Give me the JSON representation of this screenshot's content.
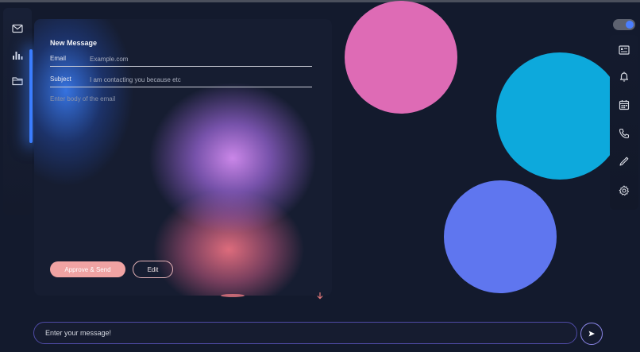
{
  "colors": {
    "background": "#131a2d",
    "accent": "#3b7dff",
    "approve_button": "#f0a3a3",
    "circle_pink": "#de6bb5",
    "circle_cyan": "#0da9dc",
    "circle_blue": "#5f76ef"
  },
  "left_sidebar": {
    "items": [
      {
        "icon": "mail-icon"
      },
      {
        "icon": "bar-chart-icon"
      },
      {
        "icon": "folder-icon"
      }
    ]
  },
  "compose": {
    "title": "New Message",
    "email": {
      "label": "Email",
      "placeholder": "Example.com"
    },
    "subject": {
      "label": "Subject",
      "placeholder": "I am contacting you because etc"
    },
    "body": {
      "placeholder": "Enter body of the email"
    },
    "approve_label": "Approve & Send",
    "edit_label": "Edit"
  },
  "right_sidebar": {
    "theme_toggle_on": true,
    "items": [
      {
        "icon": "contact-card-icon"
      },
      {
        "icon": "bell-icon"
      },
      {
        "icon": "calendar-icon"
      },
      {
        "icon": "phone-icon"
      },
      {
        "icon": "pen-icon"
      },
      {
        "icon": "gear-icon"
      }
    ]
  },
  "chat": {
    "placeholder": "Enter your message!",
    "send_icon": "send-icon"
  }
}
